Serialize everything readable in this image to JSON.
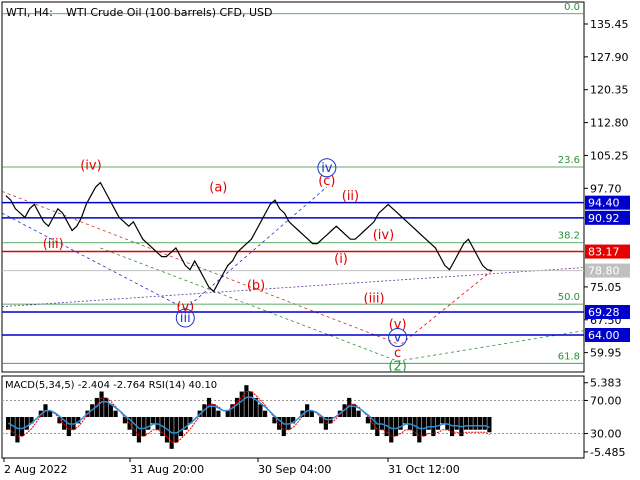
{
  "header": {
    "symbol": "WTI, H4:",
    "description": "WTI Crude Oil (100 barrels) CFD, USD"
  },
  "chart_data": [
    {
      "type": "line",
      "title": "WTI, H4: WTI Crude Oil (100 barrels) CFD, USD",
      "y_axis_ticks": [
        "135.45",
        "127.90",
        "120.35",
        "112.80",
        "105.25",
        "97.70",
        "75.05",
        "67.50",
        "59.95"
      ],
      "ylim": [
        55.5,
        140.5
      ],
      "x_ticks": [
        "2 Aug 2022",
        "31 Aug 20:00",
        "30 Sep 04:00",
        "31 Oct 12:00"
      ],
      "price_series": [
        96,
        95,
        93,
        92,
        91,
        93,
        94,
        92,
        90,
        89,
        91,
        93,
        92,
        90,
        88,
        89,
        91,
        94,
        96,
        98,
        99,
        97,
        95,
        93,
        91,
        90,
        89,
        90,
        88,
        86,
        85,
        84,
        83,
        82,
        82,
        83,
        84,
        82,
        80,
        79,
        81,
        79,
        77,
        75,
        74,
        76,
        78,
        80,
        81,
        83,
        84,
        85,
        86,
        88,
        90,
        92,
        94,
        95,
        93,
        92,
        90,
        89,
        88,
        87,
        86,
        85,
        85,
        86,
        87,
        88,
        89,
        88,
        87,
        86,
        86,
        87,
        88,
        89,
        90,
        92,
        93,
        94,
        93,
        92,
        91,
        90,
        89,
        88,
        87,
        86,
        85,
        84,
        82,
        80,
        79,
        81,
        83,
        85,
        86,
        84,
        82,
        80,
        79,
        78.8
      ],
      "levels": [
        {
          "label": "94.40",
          "value": 94.4,
          "color": "#0000cc"
        },
        {
          "label": "90.92",
          "value": 90.92,
          "color": "#0000cc"
        },
        {
          "label": "83.17",
          "value": 83.17,
          "color": "#e60000"
        },
        {
          "label": "78.80",
          "value": 78.8,
          "color": "#c0c0c0"
        },
        {
          "label": "69.28",
          "value": 69.28,
          "color": "#0000cc"
        },
        {
          "label": "64.00",
          "value": 64.0,
          "color": "#0000cc"
        }
      ],
      "fib_levels": [
        {
          "label": "0.0",
          "value": 137.8
        },
        {
          "label": "23.6",
          "value": 102.6
        },
        {
          "label": "38.2",
          "value": 85.2
        },
        {
          "label": "50.0",
          "value": 71.1
        },
        {
          "label": "61.8",
          "value": 57.5
        }
      ],
      "wave_labels": [
        {
          "text": "(iv)",
          "color": "#e60000",
          "x_index": 18,
          "value": 102.0
        },
        {
          "text": "(iii)",
          "color": "#e60000",
          "x_index": 10,
          "value": 84.0
        },
        {
          "text": "(a)",
          "color": "#e60000",
          "x_index": 45,
          "value": 97.0
        },
        {
          "text": "(b)",
          "color": "#e60000",
          "x_index": 53,
          "value": 74.5
        },
        {
          "text": "(c)",
          "color": "#e60000",
          "x_index": 68,
          "value": 98.5
        },
        {
          "text": "(v)",
          "color": "#e60000",
          "x_index": 38,
          "value": 69.5
        },
        {
          "text": "iii",
          "color": "#1a33cc",
          "x_index": 38,
          "value": 67.0
        },
        {
          "text": "iv",
          "color": "#1a33cc",
          "x_index": 68,
          "value": 101.5
        },
        {
          "text": "(ii)",
          "color": "#e60000",
          "x_index": 73,
          "value": 95.0
        },
        {
          "text": "(i)",
          "color": "#e60000",
          "x_index": 71,
          "value": 80.5
        },
        {
          "text": "(iv)",
          "color": "#e60000",
          "x_index": 80,
          "value": 86.0
        },
        {
          "text": "(iii)",
          "color": "#e60000",
          "x_index": 78,
          "value": 71.5
        },
        {
          "text": "(v)",
          "color": "#e60000",
          "x_index": 83,
          "value": 65.5
        },
        {
          "text": "v",
          "color": "#1a33cc",
          "x_index": 83,
          "value": 62.5
        },
        {
          "text": "c",
          "color": "#e60000",
          "x_index": 83,
          "value": 59.0
        },
        {
          "text": "(2)",
          "color": "#1a9c3a",
          "x_index": 83,
          "value": 55.8
        }
      ]
    },
    {
      "type": "bar",
      "title": "MACD(5,34,5) -2.404 -2.764 RSI(14) 40.10",
      "y_axis_ticks": [
        "5.383",
        "70.00",
        "30.00",
        "-5.485"
      ],
      "macd_hist": [
        -2,
        -3,
        -4,
        -3,
        -2,
        -1,
        0,
        1,
        2,
        1,
        0,
        -1,
        -2,
        -3,
        -2,
        -1,
        0,
        1,
        2,
        3,
        4,
        3,
        2,
        1,
        0,
        -1,
        -2,
        -3,
        -4,
        -3,
        -2,
        -1,
        -2,
        -3,
        -4,
        -5,
        -4,
        -3,
        -2,
        -1,
        0,
        1,
        2,
        3,
        2,
        1,
        0,
        1,
        2,
        3,
        4,
        5,
        4,
        3,
        2,
        1,
        0,
        -1,
        -2,
        -3,
        -2,
        -1,
        0,
        1,
        2,
        1,
        0,
        -1,
        -2,
        -1,
        0,
        1,
        2,
        3,
        2,
        1,
        0,
        -1,
        -2,
        -3,
        -2,
        -3,
        -4,
        -3,
        -2,
        -1,
        -2,
        -3,
        -4,
        -3,
        -2,
        -3,
        -2,
        -1,
        -2,
        -3,
        -2,
        -3,
        -2,
        -2,
        -2,
        -2,
        -2,
        -2.4
      ],
      "signal": [
        -1.8,
        -2.4,
        -3,
        -3,
        -2.5,
        -1.8,
        -0.8,
        0.2,
        1,
        1,
        0.5,
        -0.3,
        -1.2,
        -2,
        -2,
        -1.5,
        -0.6,
        0.4,
        1.2,
        2,
        3,
        3,
        2.4,
        1.6,
        0.8,
        -0.2,
        -1,
        -2,
        -3,
        -3,
        -2.6,
        -2,
        -2,
        -2.5,
        -3.2,
        -4,
        -4,
        -3.4,
        -2.6,
        -1.8,
        -0.8,
        0.2,
        1.2,
        2,
        2,
        1.6,
        1,
        1,
        1.6,
        2.4,
        3.2,
        4,
        4,
        3.4,
        2.6,
        1.8,
        0.8,
        -0.2,
        -1.2,
        -2,
        -2,
        -1.6,
        -0.8,
        0.2,
        1,
        1,
        0.6,
        -0.2,
        -1,
        -1,
        -0.4,
        0.4,
        1.2,
        2,
        2,
        1.6,
        0.8,
        0,
        -1,
        -2,
        -2,
        -2.4,
        -3,
        -3,
        -2.6,
        -2,
        -2,
        -2.4,
        -3,
        -3,
        -2.6,
        -2.6,
        -2.4,
        -2,
        -2,
        -2.4,
        -2.4,
        -2.6,
        -2.4,
        -2.4,
        -2.4,
        -2.4,
        -2.4,
        -2.764
      ]
    }
  ]
}
